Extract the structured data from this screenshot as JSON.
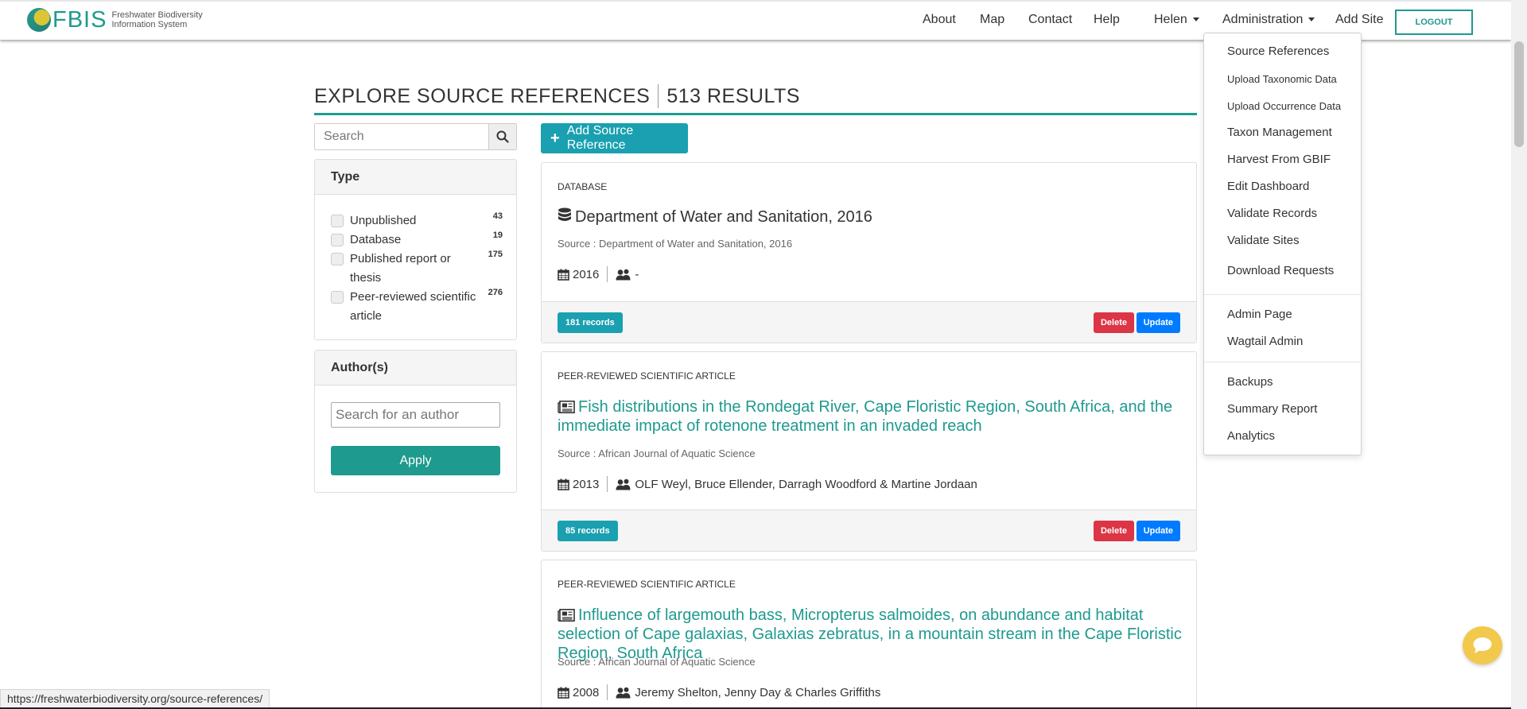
{
  "brand": {
    "logo_text": "FBIS",
    "subtitle_line1": "Freshwater Biodiversity",
    "subtitle_line2": "Information System",
    "accent_color": "#1e9a8e"
  },
  "nav": {
    "about": "About",
    "map": "Map",
    "contact": "Contact",
    "help": "Help",
    "user": "Helen",
    "administration": "Administration",
    "add_site": "Add Site",
    "logout": "LOGOUT"
  },
  "admin_menu": {
    "source_references": "Source References",
    "upload_taxonomic": "Upload Taxonomic Data",
    "upload_occurrence": "Upload Occurrence Data",
    "taxon_management": "Taxon Management",
    "harvest_gbif": "Harvest From GBIF",
    "edit_dashboard": "Edit Dashboard",
    "validate_records": "Validate Records",
    "validate_sites": "Validate Sites",
    "download_requests": "Download Requests",
    "admin_page": "Admin Page",
    "wagtail_admin": "Wagtail Admin",
    "backups": "Backups",
    "summary_report": "Summary Report",
    "analytics": "Analytics"
  },
  "page": {
    "title": "EXPLORE SOURCE REFERENCES",
    "results": "513 RESULTS"
  },
  "search": {
    "placeholder": "Search",
    "icon": "search-icon"
  },
  "type_filter": {
    "heading": "Type",
    "items": [
      {
        "label": "Unpublished",
        "count": "43"
      },
      {
        "label": "Database",
        "count": "19"
      },
      {
        "label": "Published report or thesis",
        "count": "175"
      },
      {
        "label": "Peer-reviewed scientific article",
        "count": "276"
      }
    ]
  },
  "author_filter": {
    "heading": "Author(s)",
    "placeholder": "Search for an author",
    "apply": "Apply"
  },
  "main": {
    "add_button": "Add Source Reference",
    "delete_label": "Delete",
    "update_label": "Update",
    "cards": [
      {
        "type": "DATABASE",
        "title": "Department of Water and Sanitation, 2016",
        "source": "Source : Department of Water and Sanitation, 2016",
        "year": "2016",
        "authors": "-",
        "records": "181 records"
      },
      {
        "type": "PEER-REVIEWED SCIENTIFIC ARTICLE",
        "title": "Fish distributions in the Rondegat River, Cape Floristic Region, South Africa, and the immediate impact of rotenone treatment in an invaded reach",
        "source": "Source : African Journal of Aquatic Science",
        "year": "2013",
        "authors": "OLF Weyl, Bruce Ellender, Darragh Woodford & Martine Jordaan",
        "records": "85 records"
      },
      {
        "type": "PEER-REVIEWED SCIENTIFIC ARTICLE",
        "title": "Influence of largemouth bass, Micropterus salmoides, on abundance and habitat selection of Cape galaxias, Galaxias zebratus, in a mountain stream in the Cape Floristic Region, South Africa",
        "source": "Source : African Journal of Aquatic Science",
        "year": "2008",
        "authors": "Jeremy Shelton, Jenny Day & Charles Griffiths"
      }
    ]
  },
  "statusbar": {
    "url": "https://freshwaterbiodiversity.org/source-references/"
  },
  "chat": {
    "icon": "chat-bubble-icon",
    "color": "#f2c94c"
  }
}
